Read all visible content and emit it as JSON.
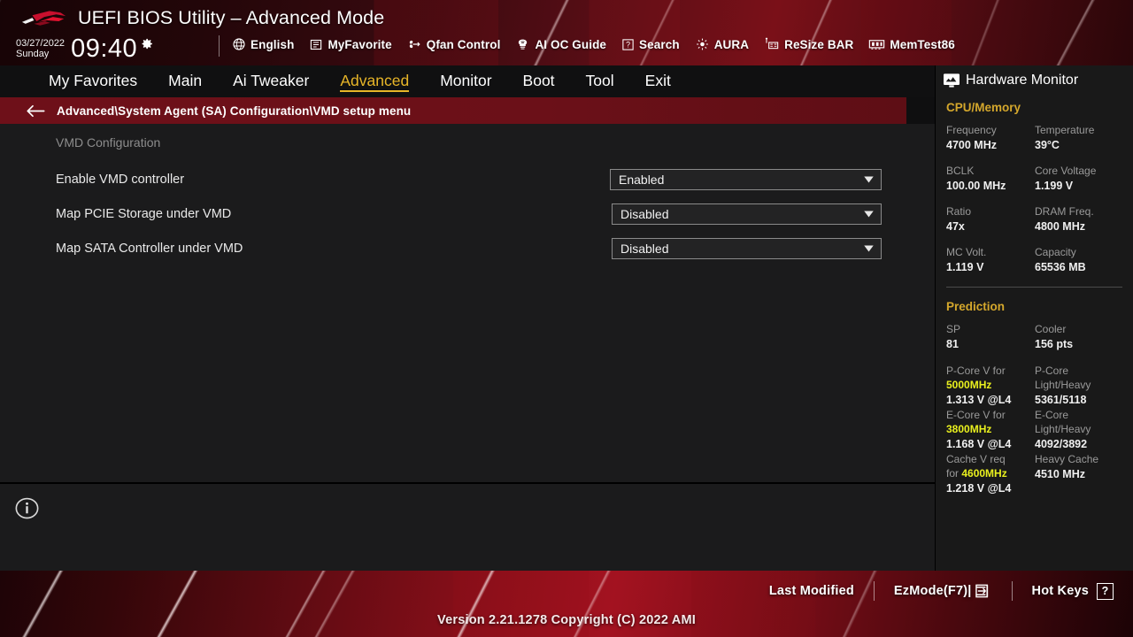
{
  "header": {
    "title": "UEFI BIOS Utility – Advanced Mode",
    "logo": "rog-logo",
    "date": "03/27/2022",
    "weekday": "Sunday",
    "time": "09:40",
    "gear_icon": "gear-icon",
    "toolbar": [
      {
        "label": "English",
        "icon": "globe-icon"
      },
      {
        "label": "MyFavorite",
        "icon": "favorites-list-icon"
      },
      {
        "label": "Qfan Control",
        "icon": "fan-icon"
      },
      {
        "label": "AI OC Guide",
        "icon": "ai-brain-icon"
      },
      {
        "label": "Search",
        "icon": "question-box-icon"
      },
      {
        "label": "AURA",
        "icon": "lighting-icon"
      },
      {
        "label": "ReSize BAR",
        "icon": "resize-bar-icon"
      },
      {
        "label": "MemTest86",
        "icon": "memory-module-icon"
      }
    ]
  },
  "tabs": [
    {
      "label": "My Favorites",
      "active": false
    },
    {
      "label": "Main",
      "active": false
    },
    {
      "label": "Ai Tweaker",
      "active": false
    },
    {
      "label": "Advanced",
      "active": true
    },
    {
      "label": "Monitor",
      "active": false
    },
    {
      "label": "Boot",
      "active": false
    },
    {
      "label": "Tool",
      "active": false
    },
    {
      "label": "Exit",
      "active": false
    }
  ],
  "breadcrumb": {
    "back_icon": "back-arrow-icon",
    "path": "Advanced\\System Agent (SA) Configuration\\VMD setup menu"
  },
  "main": {
    "section_title": "VMD Configuration",
    "settings": [
      {
        "label": "Enable VMD controller",
        "value": "Enabled"
      },
      {
        "label": "Map PCIE Storage under VMD",
        "value": "Disabled"
      },
      {
        "label": "Map SATA Controller under VMD",
        "value": "Disabled"
      }
    ],
    "info_icon": "info-circle-icon"
  },
  "hardware_monitor": {
    "title": "Hardware Monitor",
    "title_icon": "monitor-icon",
    "cpu_memory": {
      "heading": "CPU/Memory",
      "rows": [
        [
          {
            "key": "Frequency",
            "value": "4700 MHz"
          },
          {
            "key": "Temperature",
            "value": "39°C"
          }
        ],
        [
          {
            "key": "BCLK",
            "value": "100.00 MHz"
          },
          {
            "key": "Core Voltage",
            "value": "1.199 V"
          }
        ],
        [
          {
            "key": "Ratio",
            "value": "47x"
          },
          {
            "key": "DRAM Freq.",
            "value": "4800 MHz"
          }
        ],
        [
          {
            "key": "MC Volt.",
            "value": "1.119 V"
          },
          {
            "key": "Capacity",
            "value": "65536 MB"
          }
        ]
      ]
    },
    "prediction": {
      "heading": "Prediction",
      "sp_key": "SP",
      "sp_value": "81",
      "cooler_key": "Cooler",
      "cooler_value": "156 pts",
      "pcore_key_a": "P-Core V for",
      "pcore_key_b": "5000MHz",
      "pcore_value": "1.313 V @L4",
      "pcore_lh_key_a": "P-Core",
      "pcore_lh_key_b": "Light/Heavy",
      "pcore_lh_value": "5361/5118",
      "ecore_key_a": "E-Core V for",
      "ecore_key_b": "3800MHz",
      "ecore_value": "1.168 V @L4",
      "ecore_lh_key_a": "E-Core",
      "ecore_lh_key_b": "Light/Heavy",
      "ecore_lh_value": "4092/3892",
      "cache_key_a": "Cache V req",
      "cache_key_b": "for",
      "cache_key_c": "4600MHz",
      "cache_value": "1.218 V @L4",
      "heavy_cache_key": "Heavy Cache",
      "heavy_cache_value": "4510 MHz"
    }
  },
  "footer": {
    "last_modified": "Last Modified",
    "ez_mode": "EzMode(F7)|",
    "ez_mode_icon": "enter-arrow-icon",
    "hot_keys": "Hot Keys",
    "hot_keys_badge": "?",
    "version": "Version 2.21.1278 Copyright (C) 2022 AMI"
  },
  "colors": {
    "accent_gold": "#e7b528",
    "highlight_yellow": "#e9f01e",
    "crumb_red": "#6e1019",
    "panel_dark": "#1b1b1c"
  }
}
